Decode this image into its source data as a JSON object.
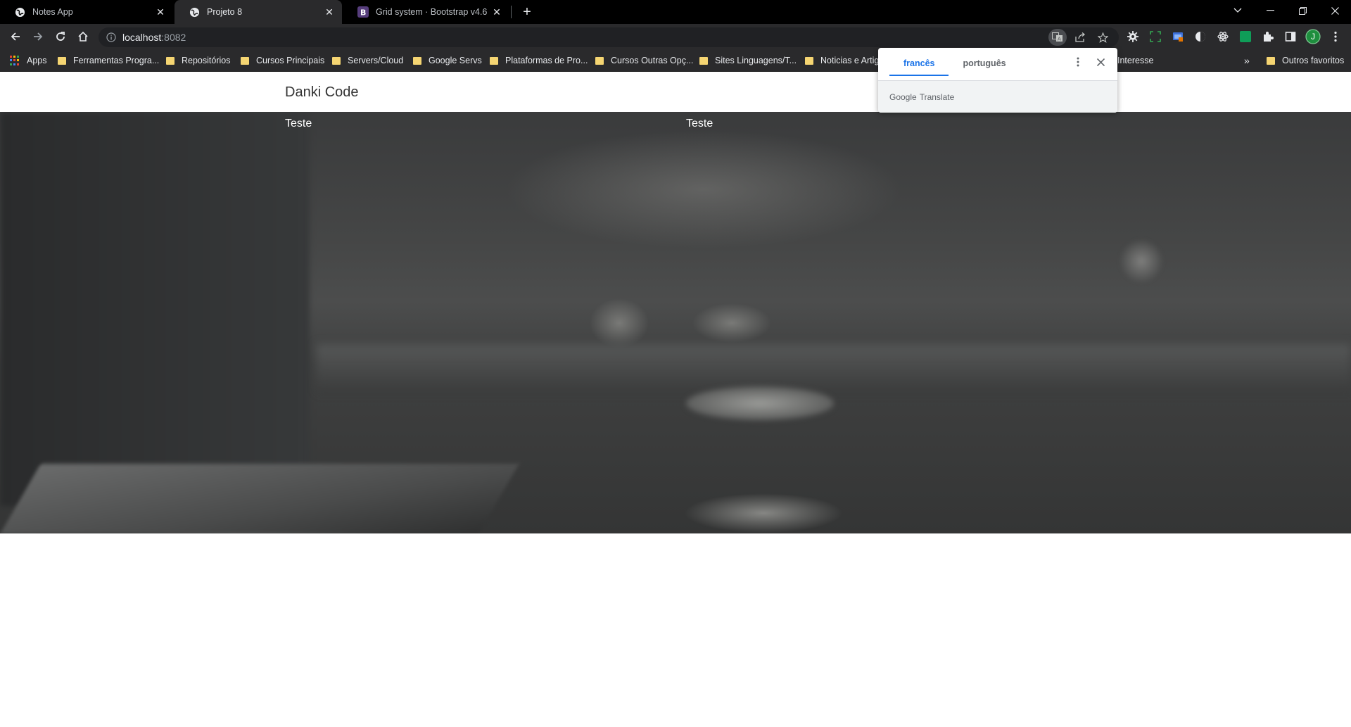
{
  "browser": {
    "tabs": [
      {
        "title": "Notes App",
        "active": false
      },
      {
        "title": "Projeto 8",
        "active": true
      },
      {
        "title": "Grid system · Bootstrap v4.6",
        "active": false
      }
    ],
    "address": {
      "host": "localhost",
      "port": ":8082"
    },
    "bookmarks": {
      "apps_label": "Apps",
      "items": [
        "Ferramentas Progra...",
        "Repositórios",
        "Cursos Principais",
        "Servers/Cloud",
        "Google Servs",
        "Plataformas de Pro...",
        "Cursos Outras Opç...",
        "Sites Linguagens/T...",
        "Noticias e Artig",
        "Interesse"
      ],
      "overflow_label": "»",
      "other_label": "Outros favoritos"
    },
    "profile_initial": "J",
    "colors": {
      "profile": "#1e8e3e",
      "ext_green": "#0f9d58",
      "folder": "#f5d572",
      "accent": "#1a73e8"
    }
  },
  "site": {
    "brand": "Danki Code",
    "columns": [
      "Teste",
      "Teste"
    ]
  },
  "translate_popup": {
    "languages": [
      "francês",
      "português"
    ],
    "selected": "francês",
    "footer_google": "Google",
    "footer_translate": "Translate"
  }
}
